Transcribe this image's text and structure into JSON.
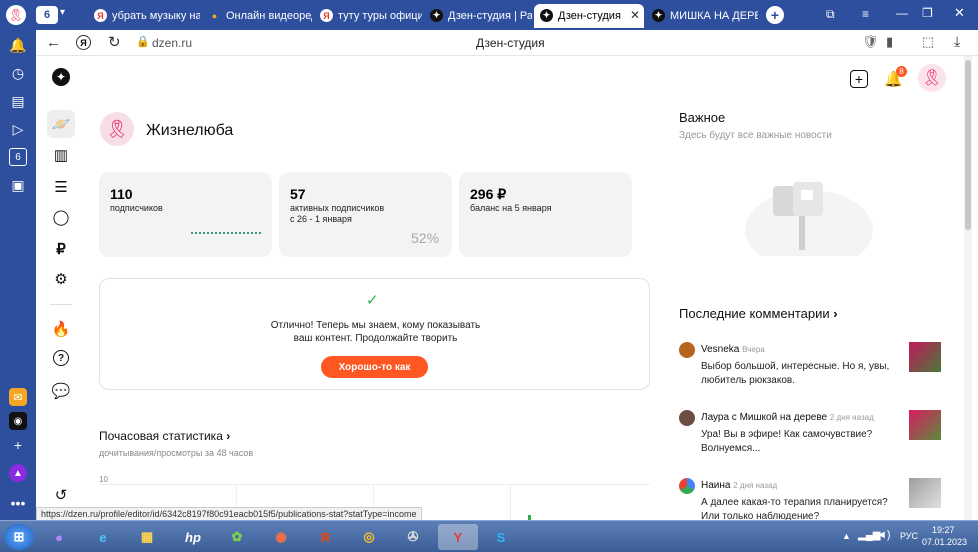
{
  "browser": {
    "tab_count": "6",
    "tabs": [
      {
        "title": "убрать музыку на ",
        "icon": "Я",
        "color": "#e53935"
      },
      {
        "title": "Онлайн видеоред",
        "icon": "●",
        "color": "#f5a623"
      },
      {
        "title": "туту туры официа",
        "icon": "Я",
        "color": "#e53935"
      },
      {
        "title": "Дзен-студия | Раб",
        "icon": "✦",
        "color": "#111"
      },
      {
        "title": "Дзен-студия",
        "icon": "✦",
        "color": "#111"
      },
      {
        "title": "МИШКА НА ДЕРЕВЕ",
        "icon": "✦",
        "color": "#111"
      }
    ],
    "new_tab": "+",
    "address": "dzen.ru",
    "page_title": "Дзен-студия",
    "status_url": "https://dzen.ru/profile/editor/id/6342c8197f80c91eacb015f5/publications-stat?statType=income"
  },
  "header": {
    "notif_count": "8"
  },
  "profile": {
    "name": "Жизнелюба"
  },
  "stats": [
    {
      "value": "110",
      "label": "подписчиков",
      "sub": "",
      "extra": ""
    },
    {
      "value": "57",
      "label": "активных подписчиков",
      "sub": "с 26 - 1 января",
      "extra": "52%"
    },
    {
      "value": "296 ₽",
      "label": "баланс на 5 января",
      "sub": "",
      "extra": ""
    }
  ],
  "notice": {
    "line1": "Отлично! Теперь мы знаем, кому показывать",
    "line2": "ваш контент. Продолжайте творить",
    "button": "Хорошо-то как"
  },
  "hourly": {
    "title": "Почасовая статистика",
    "subtitle": "дочитывания/просмотры за 48 часов",
    "axis_top": "10"
  },
  "important": {
    "title": "Важное",
    "subtitle": "Здесь будут все важные новости"
  },
  "comments": {
    "title": "Последние комментарии",
    "items": [
      {
        "author": "Vesneka",
        "time": "Вчера",
        "text1": "Выбор большой, интересные. Но я, увы,",
        "text2": "любитель рюкзаков."
      },
      {
        "author": "Лаура с Мишкой на дереве",
        "time": "2 дня назад",
        "text1": "Ура! Вы в эфире! Как самочувствие?",
        "text2": "Волнуемся..."
      },
      {
        "author": "Наина",
        "time": "2 дня назад",
        "text1": "А далее какая-то терапия планируется?",
        "text2": "Или только наблюдение?"
      }
    ]
  },
  "taskbar": {
    "lang": "РУС",
    "time": "19:27",
    "date": "07.01.2023"
  },
  "colors": {
    "accent": "#ff5722",
    "tabbar": "#2d4f9e",
    "check": "#2bb24c"
  }
}
